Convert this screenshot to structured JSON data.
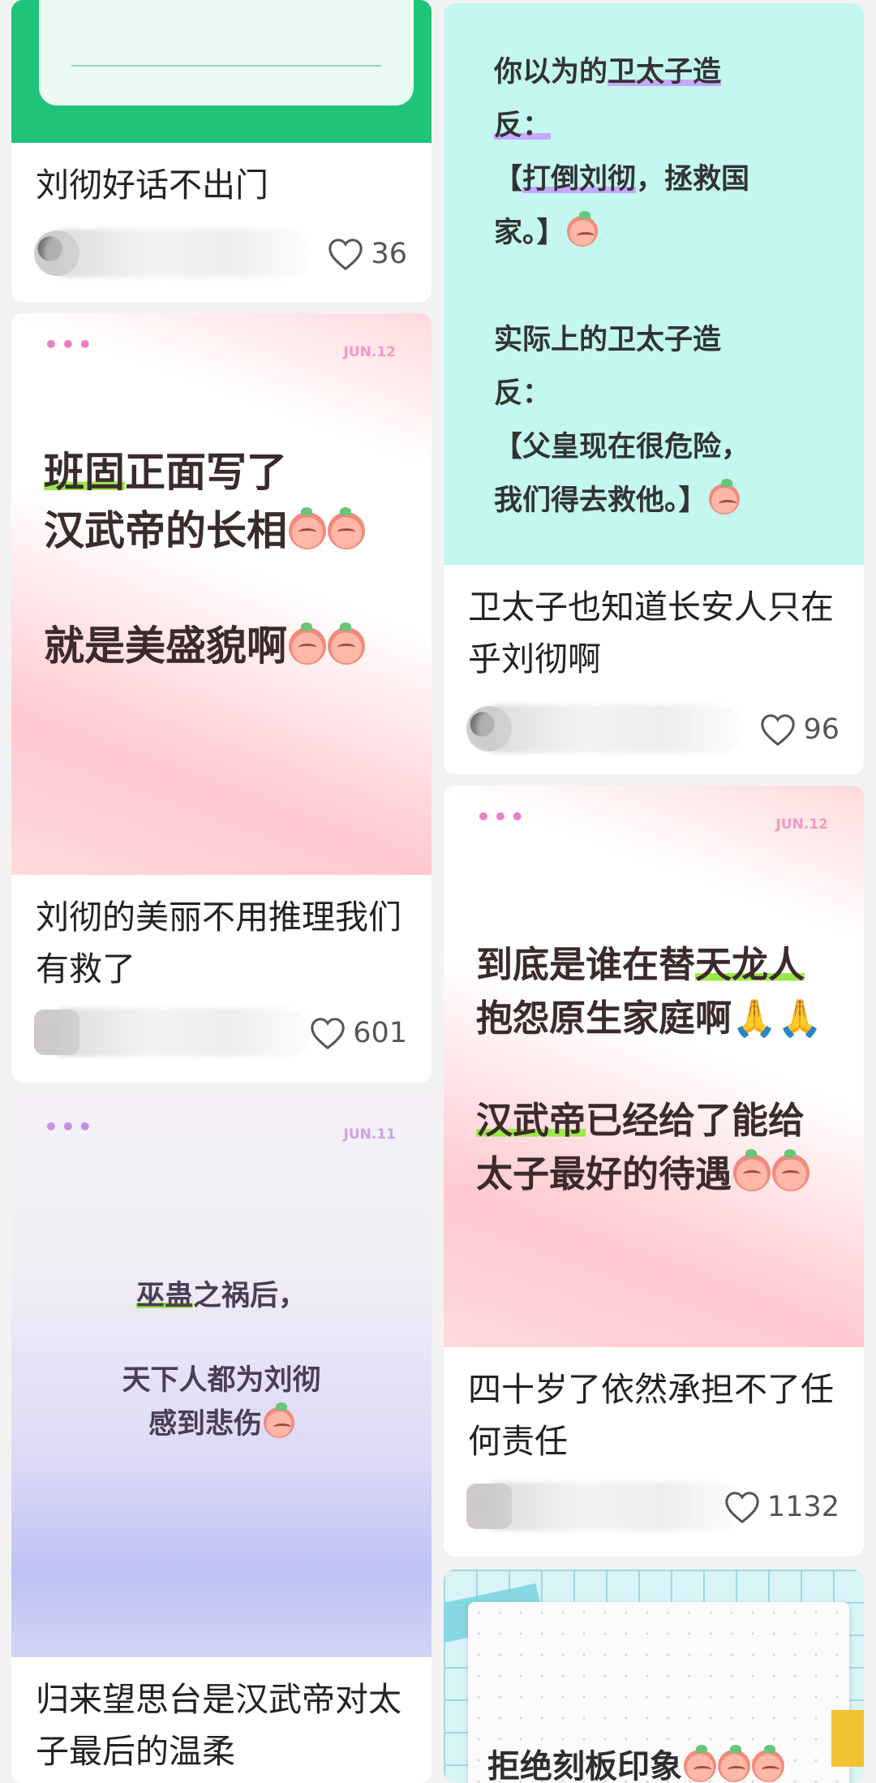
{
  "feed": {
    "left": [
      {
        "title": "刘彻好话不出门",
        "likes": "36"
      },
      {
        "title": "刘彻的美丽不用推理我们有救了",
        "likes": "601",
        "cover": {
          "dots": "•••",
          "date": "JUN.12",
          "line1_hl": "班固",
          "line1_rest": "正面写了",
          "line2": "汉武帝的长相",
          "line3": "就是美盛貌啊"
        }
      },
      {
        "title": "归来望思台是汉武帝对太子最后的温柔",
        "cover": {
          "dots": "•••",
          "date": "JUN.11",
          "line1_hl": "巫蛊",
          "line1_rest": "之祸后，",
          "line2": "天下人都为刘彻",
          "line3": "感到悲伤"
        }
      }
    ],
    "right": [
      {
        "title": "卫太子也知道长安人只在乎刘彻啊",
        "likes": "96",
        "cover": {
          "l1a": "你以为的",
          "l1b": "卫太子造",
          "l2": "反：",
          "l3a": "【",
          "l3b": "打倒刘彻",
          "l3c": "，拯救国",
          "l4": "家。】",
          "l5": "实际上的卫太子造",
          "l6": "反：",
          "l7": "【父皇现在很危险，",
          "l8": "我们得去救他。】"
        }
      },
      {
        "title": "四十岁了依然承担不了任何责任",
        "likes": "1132",
        "cover": {
          "dots": "•••",
          "date": "JUN.12",
          "line1a": "到底是谁在替",
          "line1b": "天龙人",
          "line2": "抱怨原生家庭啊",
          "line3a": "汉武帝",
          "line3b": "已经给了能给",
          "line4": "太子最好的待遇"
        }
      },
      {
        "cover": {
          "text": "拒绝刻板印象"
        }
      }
    ]
  },
  "colors": {
    "green_cover": "#1fc47a",
    "cyan_cover": "#c3f7f0",
    "highlight_green": "#9be84c",
    "highlight_purple": "#c7a9ff"
  }
}
